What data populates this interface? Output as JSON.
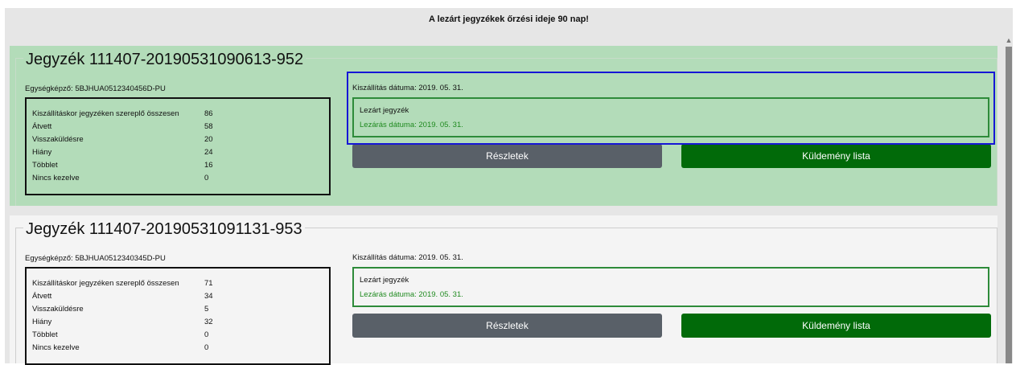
{
  "notice": "A lezárt jegyzékek őrzési ideje 90 nap!",
  "stat_labels": {
    "total": "Kiszállításkor jegyzéken szereplő összesen",
    "received": "Átvett",
    "return": "Visszaküldésre",
    "missing": "Hiány",
    "surplus": "Többlet",
    "unhandled": "Nincs kezelve"
  },
  "cards": [
    {
      "title": "Jegyzék 111407-20190531090613-952",
      "unit": "Egységképző: 5BJHUA0512340456D-PU",
      "stats": {
        "total": "86",
        "received": "58",
        "return": "20",
        "missing": "24",
        "surplus": "16",
        "unhandled": "0"
      },
      "ship_date": "Kiszállítás dátuma: 2019. 05. 31.",
      "status_title": "Lezárt jegyzék",
      "close_date": "Lezárás dátuma: 2019. 05. 31.",
      "details_button": "Részletek",
      "list_button": "Küldemény lista"
    },
    {
      "title": "Jegyzék 111407-20190531091131-953",
      "unit": "Egységképző: 5BJHUA0512340345D-PU",
      "stats": {
        "total": "71",
        "received": "34",
        "return": "5",
        "missing": "32",
        "surplus": "0",
        "unhandled": "0"
      },
      "ship_date": "Kiszállítás dátuma: 2019. 05. 31.",
      "status_title": "Lezárt jegyzék",
      "close_date": "Lezárás dátuma: 2019. 05. 31.",
      "details_button": "Részletek",
      "list_button": "Küldemény lista"
    }
  ],
  "colors": {
    "selected_card_bg": "#b3dcb9",
    "card_bg": "#f4f4f4",
    "details_button": "#596068",
    "list_button": "#016a09",
    "closed_border": "#2e8b3a",
    "closed_date_text": "#1f8a1f",
    "highlight_border": "#1616d6"
  }
}
